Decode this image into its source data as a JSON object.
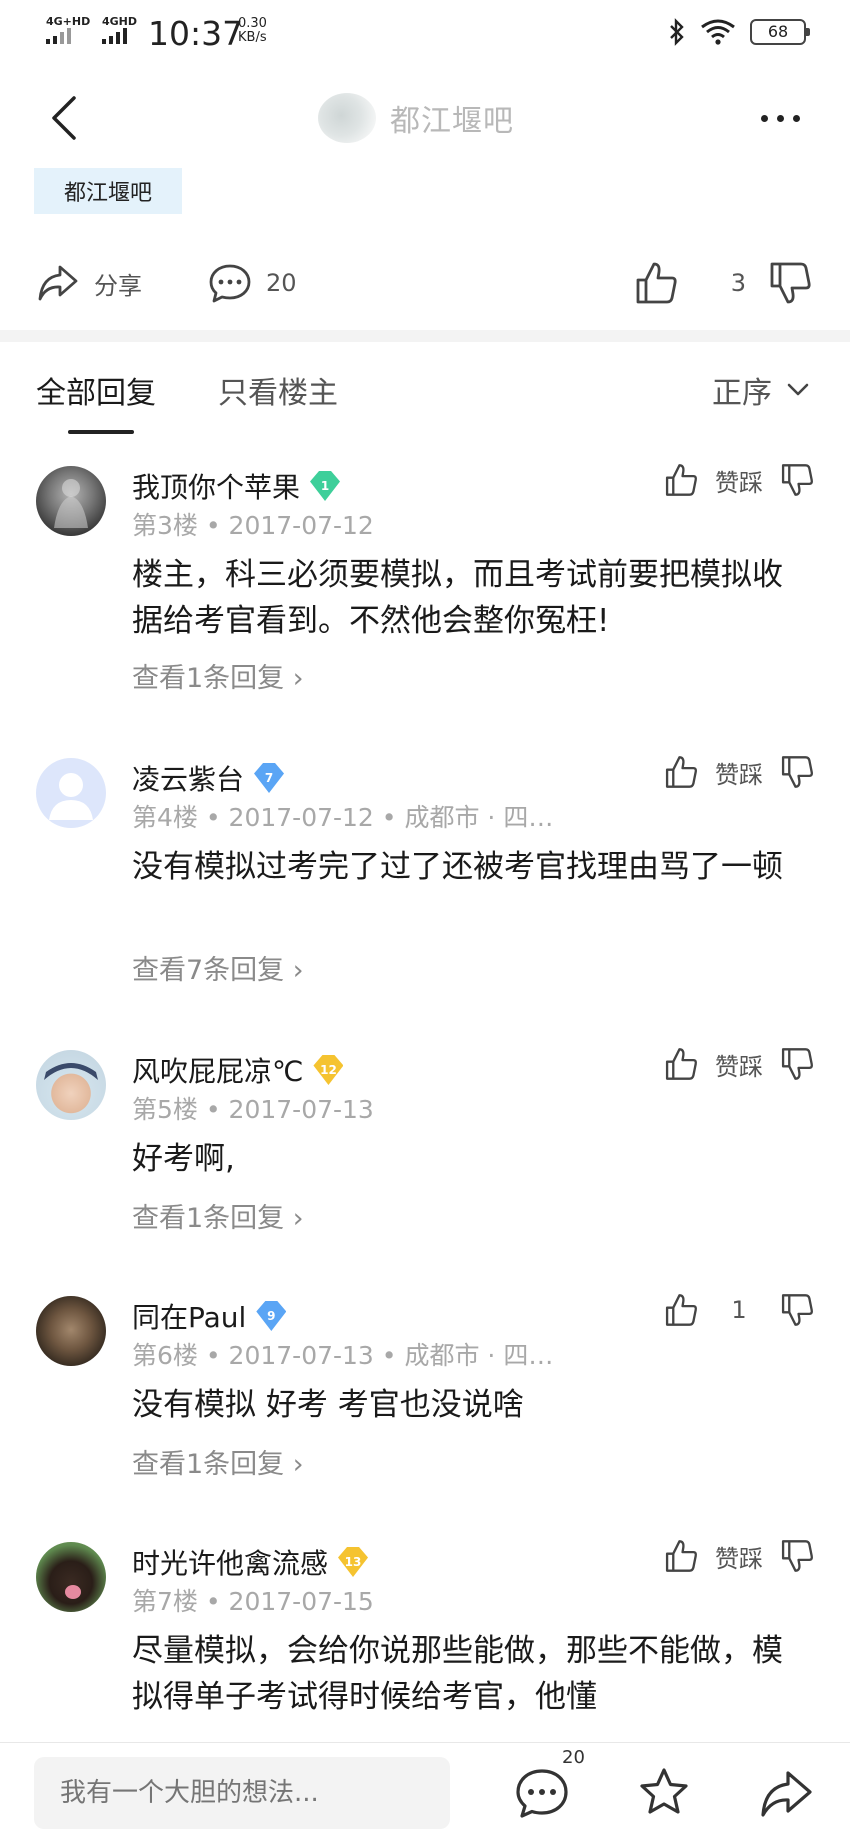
{
  "status_bar": {
    "net1": "4G+HD",
    "net2": "4GHD",
    "time": "10:37",
    "speed_value": "0.30",
    "speed_unit": "KB/s",
    "battery": "68"
  },
  "header": {
    "forum_name": "都江堰吧",
    "tag": "都江堰吧"
  },
  "actions": {
    "share_label": "分享",
    "comment_count": "20",
    "like_count": "3"
  },
  "tabs": {
    "all": "全部回复",
    "op_only": "只看楼主",
    "sort": "正序"
  },
  "replies": [
    {
      "username": "我顶你个苹果",
      "level": "1",
      "level_color": "#3ecf9a",
      "floor": "第3楼",
      "date": "2017-07-12",
      "location": "",
      "content": "楼主，科三必须要模拟，而且考试前要把模拟收据给考官看到。不然他会整你冤枉!",
      "more": "查看1条回复",
      "vote": "赞踩"
    },
    {
      "username": "凌云紫台",
      "level": "7",
      "level_color": "#5aa5f5",
      "floor": "第4楼",
      "date": "2017-07-12",
      "location": "成都市 · 四…",
      "content": "没有模拟过考完了过了还被考官找理由骂了一顿",
      "more": "查看7条回复",
      "vote": "赞踩"
    },
    {
      "username": "风吹屁屁凉℃",
      "level": "12",
      "level_color": "#f5c330",
      "floor": "第5楼",
      "date": "2017-07-13",
      "location": "",
      "content": "好考啊,",
      "more": "查看1条回复",
      "vote": "赞踩"
    },
    {
      "username": "同在Paul",
      "level": "9",
      "level_color": "#5aa5f5",
      "floor": "第6楼",
      "date": "2017-07-13",
      "location": "成都市 · 四…",
      "content": "没有模拟 好考 考官也没说啥",
      "more": "查看1条回复",
      "vote": "1"
    },
    {
      "username": "时光许他禽流感",
      "level": "13",
      "level_color": "#f5c330",
      "floor": "第7楼",
      "date": "2017-07-15",
      "location": "",
      "content": "尽量模拟，会给你说那些能做，那些不能做，模拟得单子考试得时候给考官，他懂",
      "more": "",
      "vote": "赞踩"
    }
  ],
  "bottom_bar": {
    "placeholder": "我有一个大胆的想法...",
    "comment_badge": "20"
  }
}
